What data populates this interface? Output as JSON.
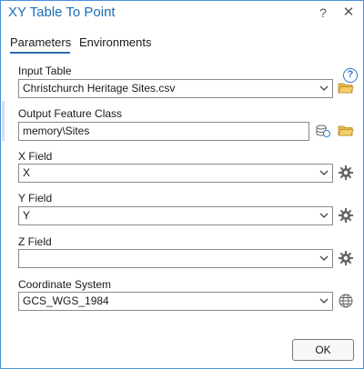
{
  "window": {
    "title": "XY Table To Point",
    "help_glyph": "?",
    "close_glyph": "✕"
  },
  "tabs": [
    {
      "label": "Parameters"
    },
    {
      "label": "Environments"
    }
  ],
  "help_icon": {
    "glyph": "?"
  },
  "fields": {
    "input_table": {
      "label": "Input Table",
      "value": "Christchurch Heritage Sites.csv"
    },
    "output_feature_class": {
      "label": "Output Feature Class",
      "value": "memory\\Sites"
    },
    "x_field": {
      "label": "X Field",
      "value": "X"
    },
    "y_field": {
      "label": "Y Field",
      "value": "Y"
    },
    "z_field": {
      "label": "Z Field",
      "value": ""
    },
    "coordinate_system": {
      "label": "Coordinate System",
      "value": "GCS_WGS_1984"
    }
  },
  "buttons": {
    "ok_label": "OK"
  },
  "colors": {
    "accent": "#1a6fb5",
    "folder": "#e2b53c",
    "border": "#4a8fd8"
  }
}
